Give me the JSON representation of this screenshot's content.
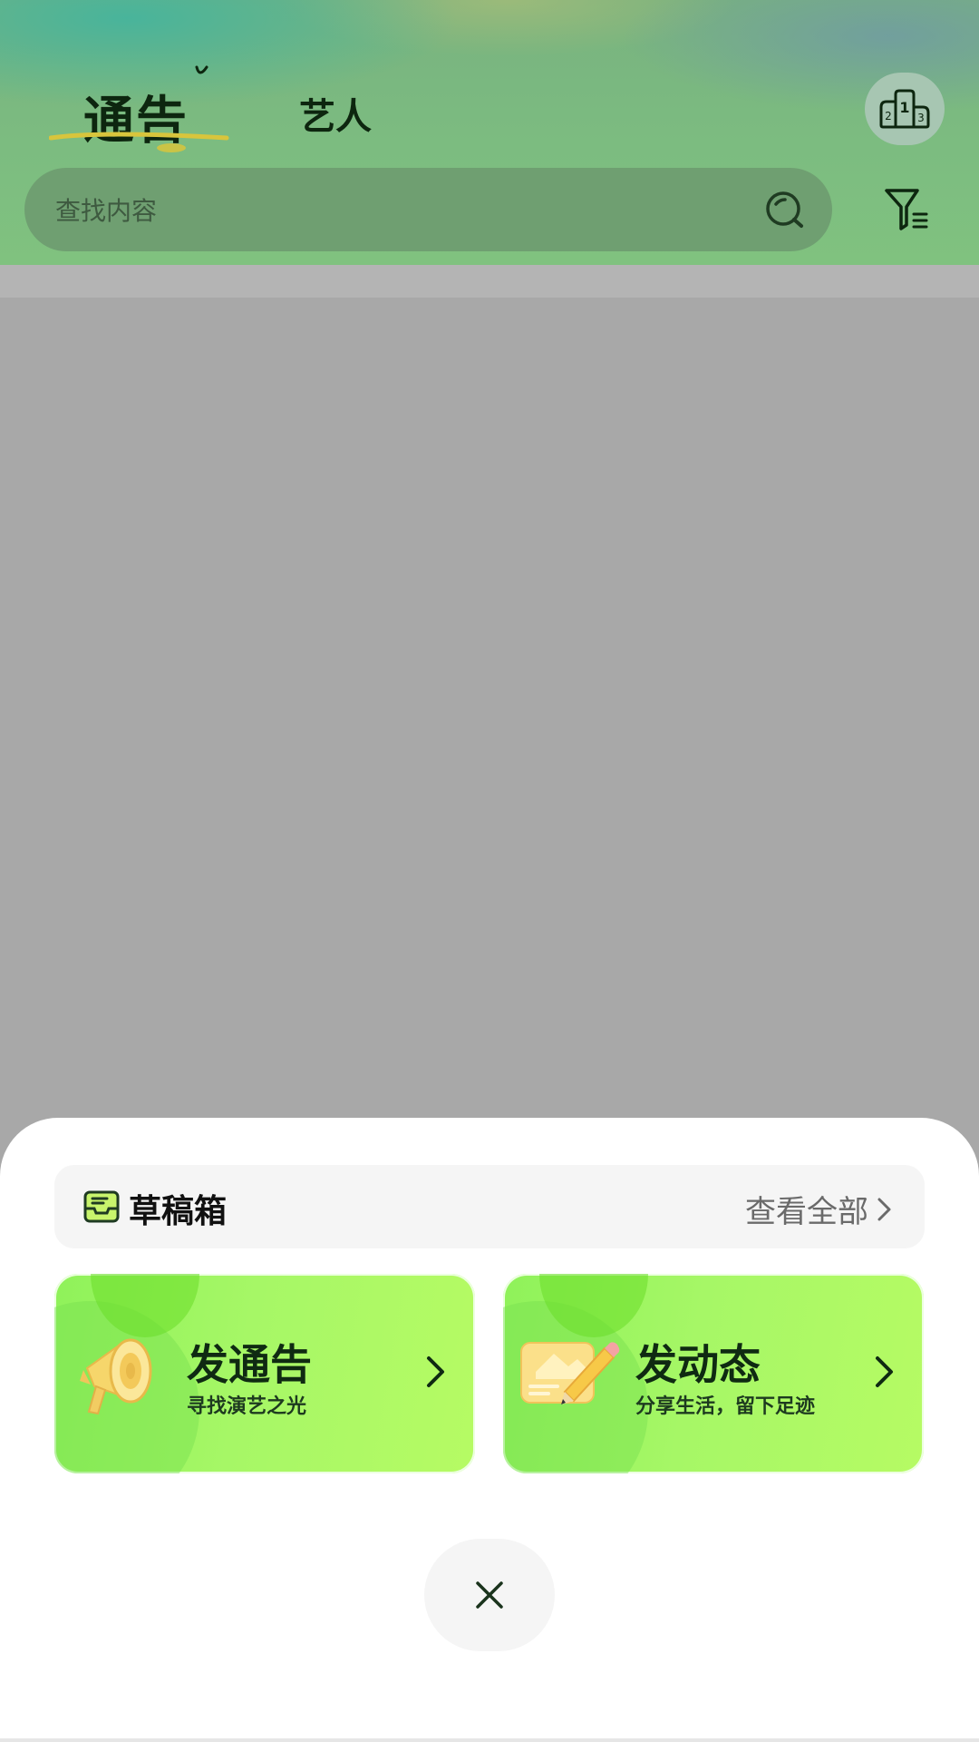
{
  "header": {
    "tabs": [
      {
        "label": "通告",
        "active": true
      },
      {
        "label": "艺人",
        "active": false
      }
    ],
    "rank_icon": "podium-icon",
    "search": {
      "placeholder": "查找内容",
      "icon": "search-icon"
    },
    "filter_icon": "filter-list-icon"
  },
  "sheet": {
    "drafts": {
      "icon": "inbox-icon",
      "label": "草稿箱",
      "view_all": "查看全部"
    },
    "cards": [
      {
        "title": "发通告",
        "subtitle": "寻找演艺之光",
        "icon": "megaphone-icon"
      },
      {
        "title": "发动态",
        "subtitle": "分享生活，留下足迹",
        "icon": "picture-pencil-icon"
      }
    ],
    "close_icon": "close-icon"
  },
  "colors": {
    "header_green": "#7cbc80",
    "card_green": "#a6f766",
    "overlay_gray": "#a8a8a8",
    "text_dark": "#0d260f"
  }
}
